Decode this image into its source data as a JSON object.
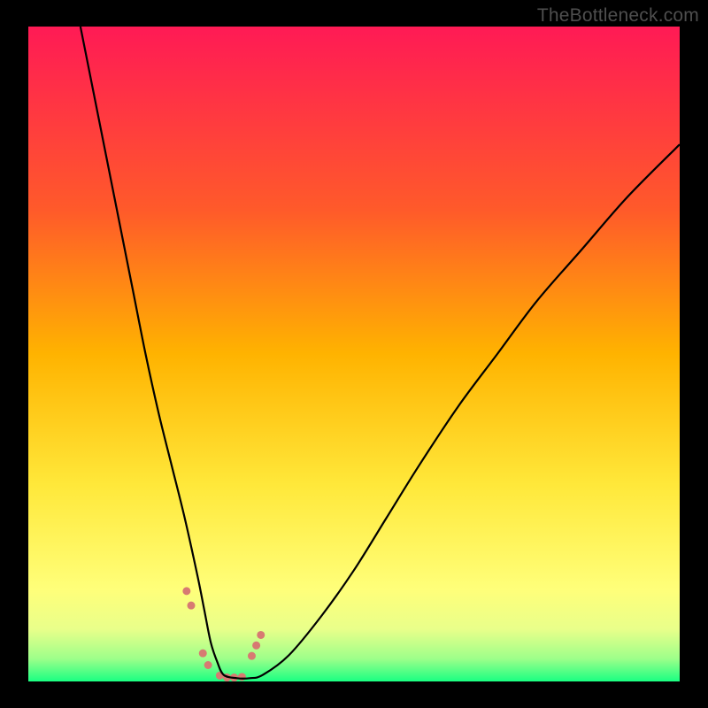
{
  "watermark": "TheBottleneck.com",
  "chart_data": {
    "type": "line",
    "title": "",
    "xlabel": "",
    "ylabel": "",
    "xlim": [
      0,
      100
    ],
    "ylim": [
      0,
      100
    ],
    "gradient_stops": [
      {
        "offset": 0.0,
        "color": "#ff1a55"
      },
      {
        "offset": 0.28,
        "color": "#ff5a2a"
      },
      {
        "offset": 0.5,
        "color": "#ffb300"
      },
      {
        "offset": 0.7,
        "color": "#ffe83a"
      },
      {
        "offset": 0.86,
        "color": "#ffff7a"
      },
      {
        "offset": 0.92,
        "color": "#e9ff8a"
      },
      {
        "offset": 0.965,
        "color": "#9eff8a"
      },
      {
        "offset": 1.0,
        "color": "#1aff82"
      }
    ],
    "series": [
      {
        "name": "bottleneck-curve",
        "stroke": "#000000",
        "x": [
          8,
          10,
          12,
          14,
          16,
          18,
          20,
          22,
          24,
          26,
          27,
          28,
          29,
          30,
          32,
          34,
          36,
          40,
          45,
          50,
          55,
          60,
          66,
          72,
          78,
          85,
          92,
          100
        ],
        "values": [
          100,
          90,
          80,
          70,
          60,
          50,
          41,
          33,
          25,
          16,
          11,
          6,
          3,
          1,
          0.5,
          0.5,
          1,
          4,
          10,
          17,
          25,
          33,
          42,
          50,
          58,
          66,
          74,
          82
        ]
      }
    ],
    "markers": {
      "name": "highlight-points",
      "color": "#d77a72",
      "radius": 4.5,
      "x": [
        24.3,
        25.0,
        26.8,
        27.6,
        29.4,
        30.5,
        31.6,
        32.8,
        34.3,
        35.0,
        35.7
      ],
      "values": [
        13.8,
        11.6,
        4.3,
        2.5,
        0.9,
        0.6,
        0.6,
        0.7,
        3.9,
        5.5,
        7.1
      ]
    }
  }
}
